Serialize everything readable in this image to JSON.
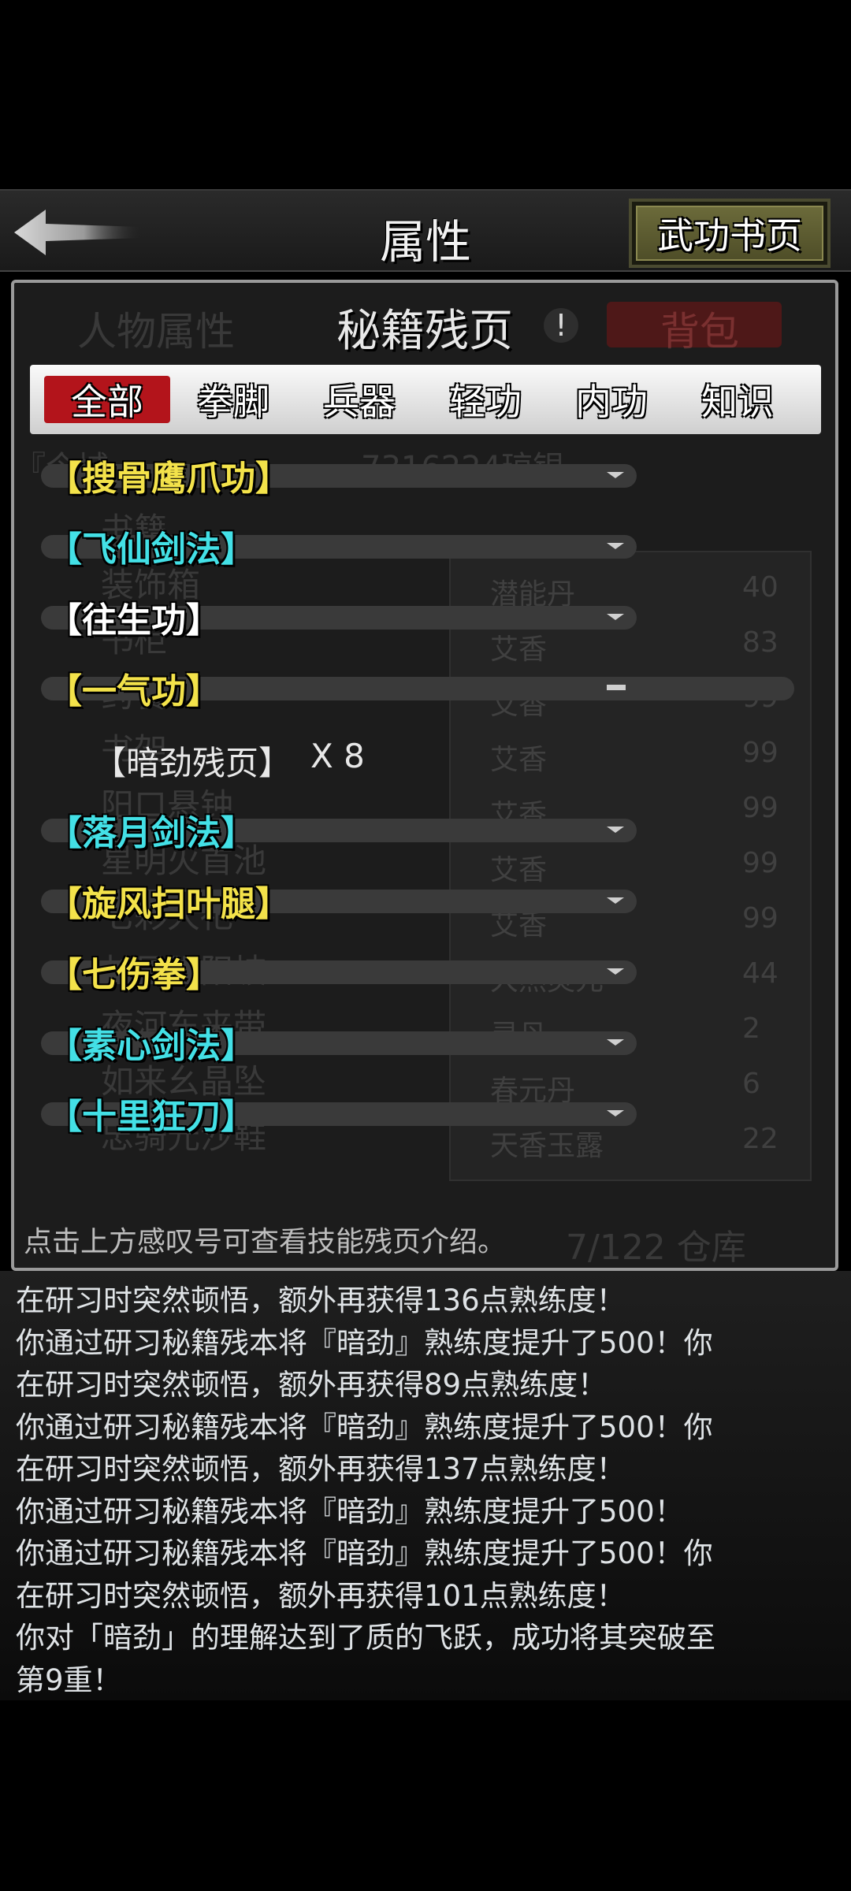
{
  "header": {
    "title": "属性",
    "book_button": "武功书页"
  },
  "panel": {
    "title": "秘籍残页",
    "info_mark": "!",
    "background_text": {
      "left_tab": "人物属性",
      "right_tab": "背包",
      "top_line": "『今城",
      "top_line_right": "7316224琼银",
      "items_left": [
        "书籍",
        "装饰箱",
        "书柜",
        "药餐",
        "书架",
        "阳口悬钟",
        "星明火首池",
        "七彩大祀",
        "长风阴阳坡",
        "夜河东来带",
        "如来幺晶坠",
        "忠骑元沙鞋"
      ],
      "items_mid": [
        "潜能丹",
        "艾香",
        "艾香",
        "艾香",
        "艾香",
        "艾香",
        "艾香",
        "大然灵元",
        "灵丹",
        "春元丹",
        "天香玉露"
      ],
      "items_num": [
        "40",
        "83",
        "99",
        "99",
        "99",
        "99",
        "99",
        "44",
        "2",
        "6",
        "22"
      ],
      "capacity": "7/122 仓库"
    },
    "tabs": [
      "全部",
      "拳脚",
      "兵器",
      "轻功",
      "内功",
      "知识"
    ],
    "active_tab": "全部",
    "skills": [
      {
        "name": "【搜骨鹰爪功】",
        "color": "#f3e24a",
        "expanded": false
      },
      {
        "name": "【飞仙剑法】",
        "color": "#43e0e6",
        "expanded": false
      },
      {
        "name": "【往生功】",
        "color": "#ffffff",
        "expanded": false
      },
      {
        "name": "【一气功】",
        "color": "#f3e24a",
        "expanded": true,
        "pages": [
          {
            "name": "【暗劲残页】",
            "count": "X 8"
          }
        ]
      },
      {
        "name": "【落月剑法】",
        "color": "#43e0e6",
        "expanded": false
      },
      {
        "name": "【旋风扫叶腿】",
        "color": "#f3e24a",
        "expanded": false
      },
      {
        "name": "【七伤拳】",
        "color": "#f3e24a",
        "expanded": false
      },
      {
        "name": "【素心剑法】",
        "color": "#43e0e6",
        "expanded": false
      },
      {
        "name": "【十里狂刀】",
        "color": "#43e0e6",
        "expanded": false
      }
    ],
    "hint": "点击上方感叹号可查看技能残页介绍。"
  },
  "log": [
    "在研习时突然顿悟，额外再获得136点熟练度！",
    "你通过研习秘籍残本将『暗劲』熟练度提升了500！你",
    "在研习时突然顿悟，额外再获得89点熟练度！",
    "你通过研习秘籍残本将『暗劲』熟练度提升了500！你",
    "在研习时突然顿悟，额外再获得137点熟练度！",
    "你通过研习秘籍残本将『暗劲』熟练度提升了500！",
    "你通过研习秘籍残本将『暗劲』熟练度提升了500！你",
    "在研习时突然顿悟，额外再获得101点熟练度！",
    "你对「暗劲」的理解达到了质的飞跃，成功将其突破至",
    "第9重！"
  ]
}
